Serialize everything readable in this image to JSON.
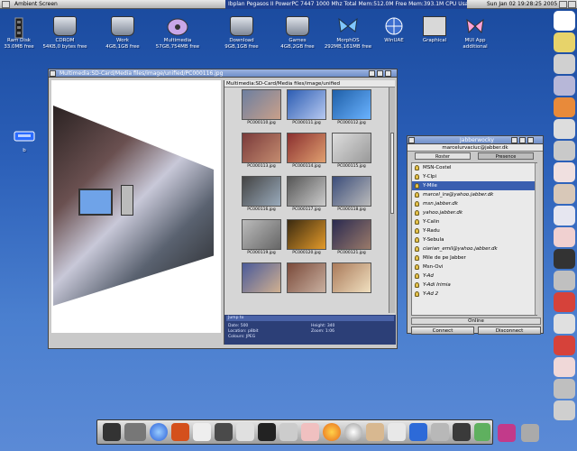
{
  "topbar": {
    "screen_title": "Ambient Screen",
    "sysinfo": "Ibplan Pegasos II PowerPC 7447 1000 Mhz Total Mem:512.0M Free Mem:393.1M  CPU Usage:0.9",
    "clock": "Sun Jan 02 19:28:25 2005"
  },
  "desktop_icons": [
    {
      "label": "Ram Disk",
      "sub": "33.0MB free"
    },
    {
      "label": "CDROM",
      "sub": "54KB,0 bytes free"
    },
    {
      "label": "Work",
      "sub": "4GB,1GB free"
    },
    {
      "label": "Multimedia",
      "sub": "57GB,754MB free"
    },
    {
      "label": "Download",
      "sub": "9GB,1GB free"
    },
    {
      "label": "Games",
      "sub": "4GB,2GB free"
    },
    {
      "label": "MorphOS",
      "sub": "292MB,161MB free"
    },
    {
      "label": "WinUAE",
      "sub": ""
    },
    {
      "label": "Graphical",
      "sub": ""
    },
    {
      "label": "MUI App",
      "sub": "additional"
    },
    {
      "label": "b",
      "sub": ""
    }
  ],
  "viewer_window": {
    "title": "Multimedia:SD-Card/Media files/image/unified/PC000116.jpg",
    "browser_path": "Multimedia:SD-Card/Media files/image/unified",
    "thumbnails": [
      "PC000110.jpg",
      "PC000111.jpg",
      "PC000112.jpg",
      "PC000113.jpg",
      "PC000114.jpg",
      "PC000115.jpg",
      "PC000116.jpg",
      "PC000117.jpg",
      "PC000118.jpg",
      "PC000119.jpg",
      "PC000120.jpg",
      "PC000121.jpg",
      "",
      "",
      ""
    ],
    "info": {
      "title": "Jump to",
      "left": [
        "Date:   500",
        "Location:  p8bit",
        "Colours:  JPEG"
      ],
      "right": [
        "Height:  340",
        "Zoom:   1:06"
      ]
    }
  },
  "jabber_window": {
    "title": "Jabberwocky",
    "account": "marcelurvaciuc@jabber.dk",
    "tabs": [
      "Roster",
      "Presence"
    ],
    "roster": [
      {
        "name": "MSN-Costel",
        "style": "normal"
      },
      {
        "name": "Y-Clpi",
        "style": "normal"
      },
      {
        "name": "Y-Mile",
        "style": "selected"
      },
      {
        "name": "marcel_ira@yahoo.jabber.dk",
        "style": "italic"
      },
      {
        "name": "msn.jabber.dk",
        "style": "italic"
      },
      {
        "name": "yahoo.jabber.dk",
        "style": "italic"
      },
      {
        "name": "Y-Calin",
        "style": "normal"
      },
      {
        "name": "Y-Radu",
        "style": "normal"
      },
      {
        "name": "Y-Sebula",
        "style": "normal"
      },
      {
        "name": "ciarian_emil@yahoo.jabber.dk",
        "style": "italic"
      },
      {
        "name": "Mile de pe Jabber",
        "style": "normal"
      },
      {
        "name": "Msn-Ovi",
        "style": "normal"
      },
      {
        "name": "Y-Ad",
        "style": "italic"
      },
      {
        "name": "Y-Adi Irimia",
        "style": "italic"
      },
      {
        "name": "Y-Ad 2",
        "style": "italic"
      }
    ],
    "status": "Online",
    "connect_label": "Connect",
    "disconnect_label": "Disconnect"
  },
  "colors": {
    "desktop_top": "#1a4a9e",
    "desktop_bottom": "#5b8ad6",
    "title_active": "#6f8fc8",
    "selection": "#3a5fb0"
  },
  "right_dock_icons": [
    "morphos-icon",
    "music-icon",
    "media-player-icon",
    "cross-tool-icon",
    "paint-icon",
    "glasses-icon",
    "scissors-icon",
    "magnifier-icon",
    "tools-icon",
    "cross-tool-icon",
    "magnifier-icon",
    "camera-icon",
    "scissors-icon",
    "pdf-icon",
    "cross-tool-icon",
    "pdf-icon",
    "magnifier-icon",
    "tools-icon",
    "scissors-icon"
  ],
  "bottom_dock_icons": [
    "shell-icon",
    "prefs-icon",
    "globe-icon",
    "scorpion-icon",
    "headphones-icon",
    "person-icon",
    "pen-icon",
    "media-icon",
    "mail-icon",
    "chat-icon",
    "sun-icon",
    "ball-icon",
    "cat-icon",
    "network-icon",
    "drive-icon",
    "camera-icon",
    "memory-icon",
    "editor-icon",
    "shutdown-icon",
    "printer-icon"
  ]
}
